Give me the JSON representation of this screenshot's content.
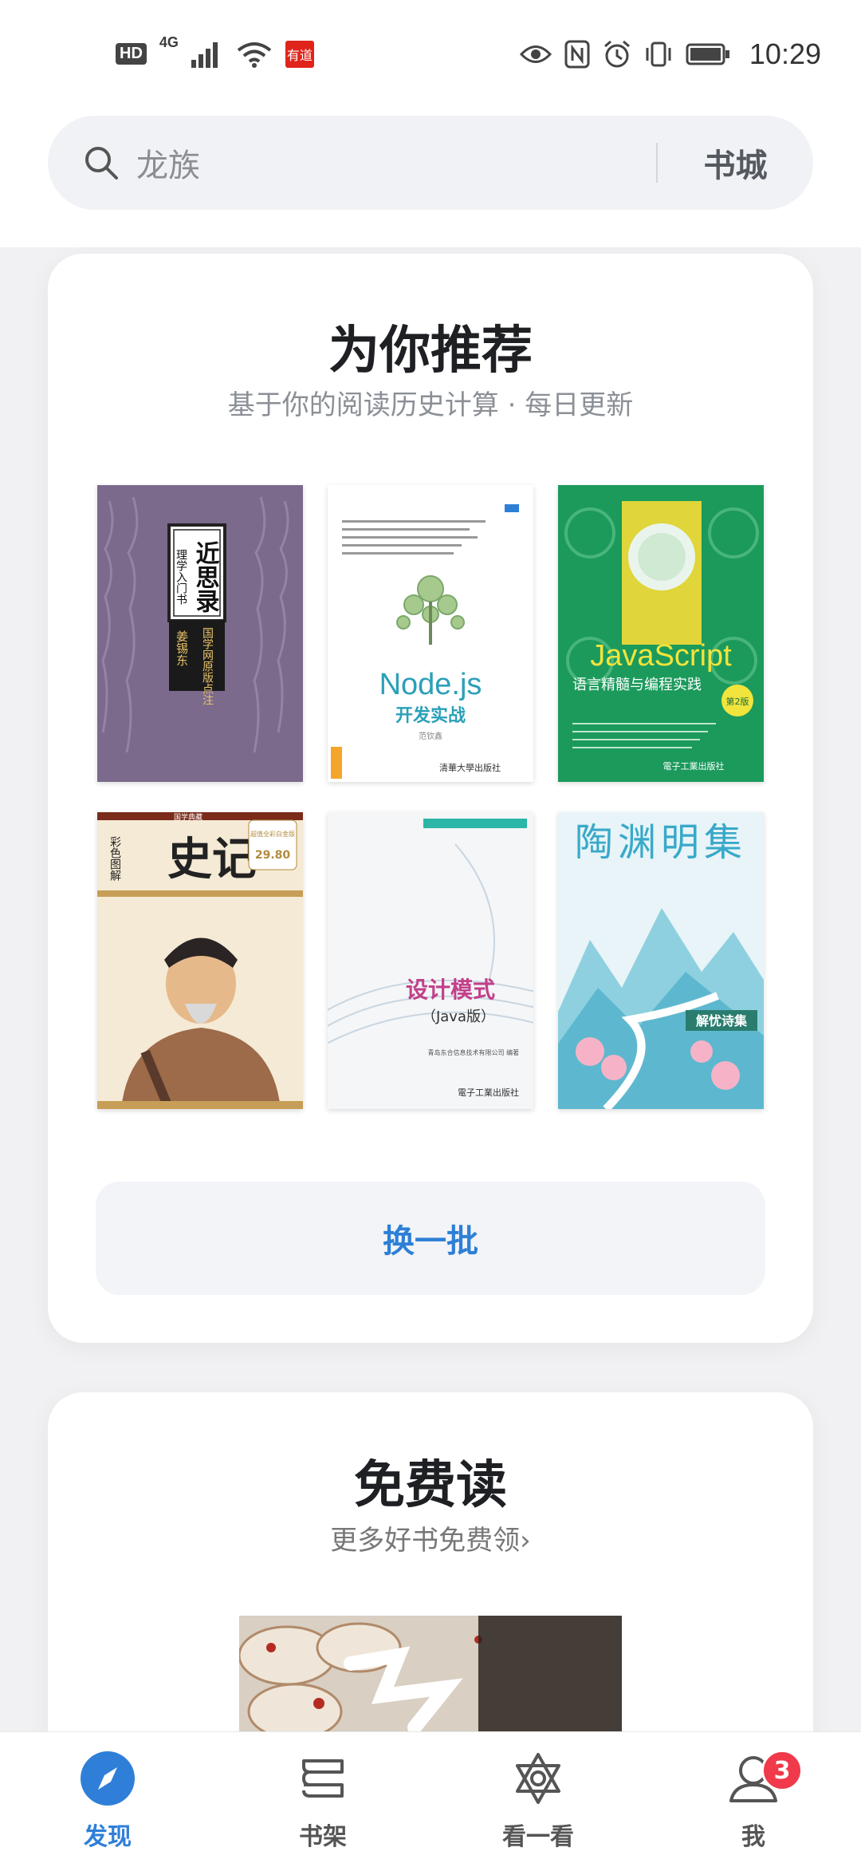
{
  "status_bar": {
    "hd": "HD",
    "network": "4G",
    "app_badge": "有道",
    "time": "10:29"
  },
  "search": {
    "query": "龙族",
    "store_label": "书城"
  },
  "recommend": {
    "title": "为你推荐",
    "subtitle": "基于你的阅读历史计算 · 每日更新",
    "refresh_label": "换一批",
    "books": [
      {
        "title": "近思录",
        "subtitle": "理学入门书",
        "author": "姜锡东",
        "note": "国学网原版点注",
        "cover_color": "#7b6a8c"
      },
      {
        "title": "Node.js",
        "subtitle": "开发实战",
        "author": "范钦鑫",
        "publisher": "清華大學出版社",
        "cover_color": "#ffffff"
      },
      {
        "title": "JavaScript",
        "subtitle": "语言精髓与编程实践",
        "edition": "第2版",
        "publisher": "電子工業出版社",
        "cover_color": "#1b9a5c"
      },
      {
        "title": "史记",
        "series": "国学典藏",
        "note": "彩色图解",
        "price": "29.80",
        "edition_note": "超值全彩白金版",
        "cover_color": "#f4ead5"
      },
      {
        "title": "设计模式",
        "subtitle": "（Java版）",
        "author": "青岛东合信息技术有限公司 编著",
        "publisher": "電子工業出版社",
        "cover_color": "#f4f6f8"
      },
      {
        "title": "陶渊明集",
        "subtitle": "解忧诗集",
        "cover_color": "#e8f4f8"
      }
    ]
  },
  "free": {
    "title": "免费读",
    "subtitle": "更多好书免费领›"
  },
  "nav": [
    {
      "label": "发现",
      "active": true
    },
    {
      "label": "书架",
      "active": false
    },
    {
      "label": "看一看",
      "active": false
    },
    {
      "label": "我",
      "active": false,
      "badge": "3"
    }
  ],
  "colors": {
    "accent": "#2f7fd9",
    "badge": "#f0394a"
  }
}
